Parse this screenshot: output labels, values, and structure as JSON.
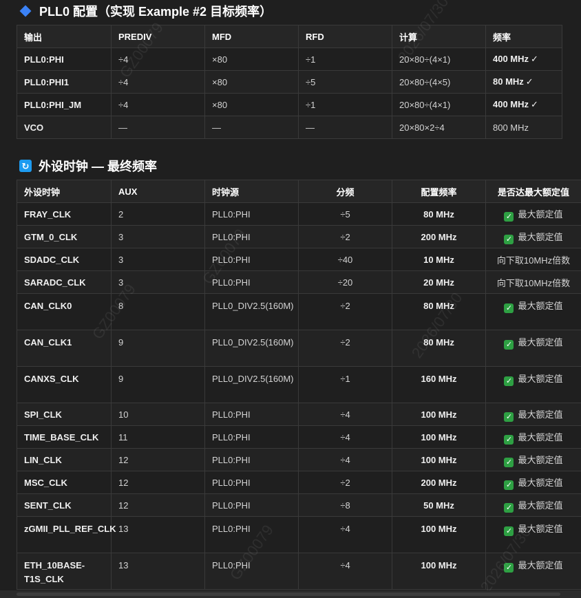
{
  "pll": {
    "title": "PLL0 配置（实现 Example #2 目标频率）",
    "headers": [
      "输出",
      "PREDIV",
      "MFD",
      "RFD",
      "计算",
      "频率"
    ],
    "rows": [
      {
        "out": "PLL0:PHI",
        "prediv": "÷4",
        "mfd": "×80",
        "rfd": "÷1",
        "calc": "20×80÷(4×1)",
        "freq": "400 MHz",
        "check": "✓"
      },
      {
        "out": "PLL0:PHI1",
        "prediv": "÷4",
        "mfd": "×80",
        "rfd": "÷5",
        "calc": "20×80÷(4×5)",
        "freq": "80 MHz",
        "check": "✓"
      },
      {
        "out": "PLL0:PHI_JM",
        "prediv": "÷4",
        "mfd": "×80",
        "rfd": "÷1",
        "calc": "20×80÷(4×1)",
        "freq": "400 MHz",
        "check": "✓"
      },
      {
        "out": "VCO",
        "prediv": "—",
        "mfd": "—",
        "rfd": "—",
        "calc": "20×80×2÷4",
        "freq": "800 MHz",
        "check": ""
      }
    ]
  },
  "periph": {
    "title": "外设时钟 — 最终频率",
    "headers": [
      "外设时钟",
      "AUX",
      "时钟源",
      "分频",
      "配置频率",
      "是否达最大额定值"
    ],
    "rows": [
      {
        "name": "FRAY_CLK",
        "aux": "2",
        "src": "PLL0:PHI",
        "div": "÷5",
        "freq": "80 MHz",
        "status": "最大额定值",
        "ok": true
      },
      {
        "name": "GTM_0_CLK",
        "aux": "3",
        "src": "PLL0:PHI",
        "div": "÷2",
        "freq": "200 MHz",
        "status": "最大额定值",
        "ok": true
      },
      {
        "name": "SDADC_CLK",
        "aux": "3",
        "src": "PLL0:PHI",
        "div": "÷40",
        "freq": "10 MHz",
        "status": "向下取10MHz倍数",
        "ok": false
      },
      {
        "name": "SARADC_CLK",
        "aux": "3",
        "src": "PLL0:PHI",
        "div": "÷20",
        "freq": "20 MHz",
        "status": "向下取10MHz倍数",
        "ok": false
      },
      {
        "name": "CAN_CLK0",
        "aux": "8",
        "src": "PLL0_DIV2.5(160M)",
        "div": "÷2",
        "freq": "80 MHz",
        "status": "最大额定值",
        "ok": true,
        "tall": true
      },
      {
        "name": "CAN_CLK1",
        "aux": "9",
        "src": "PLL0_DIV2.5(160M)",
        "div": "÷2",
        "freq": "80 MHz",
        "status": "最大额定值",
        "ok": true,
        "tall": true
      },
      {
        "name": "CANXS_CLK",
        "aux": "9",
        "src": "PLL0_DIV2.5(160M)",
        "div": "÷1",
        "freq": "160 MHz",
        "status": "最大额定值",
        "ok": true,
        "tall": true
      },
      {
        "name": "SPI_CLK",
        "aux": "10",
        "src": "PLL0:PHI",
        "div": "÷4",
        "freq": "100 MHz",
        "status": "最大额定值",
        "ok": true
      },
      {
        "name": "TIME_BASE_CLK",
        "aux": "11",
        "src": "PLL0:PHI",
        "div": "÷4",
        "freq": "100 MHz",
        "status": "最大额定值",
        "ok": true
      },
      {
        "name": "LIN_CLK",
        "aux": "12",
        "src": "PLL0:PHI",
        "div": "÷4",
        "freq": "100 MHz",
        "status": "最大额定值",
        "ok": true
      },
      {
        "name": "MSC_CLK",
        "aux": "12",
        "src": "PLL0:PHI",
        "div": "÷2",
        "freq": "200 MHz",
        "status": "最大额定值",
        "ok": true
      },
      {
        "name": "SENT_CLK",
        "aux": "12",
        "src": "PLL0:PHI",
        "div": "÷8",
        "freq": "50 MHz",
        "status": "最大额定值",
        "ok": true
      },
      {
        "name": "zGMII_PLL_REF_CLK",
        "aux": "13",
        "src": "PLL0:PHI",
        "div": "÷4",
        "freq": "100 MHz",
        "status": "最大额定值",
        "ok": true,
        "tall": true
      },
      {
        "name": "ETH_10BASE-T1S_CLK",
        "aux": "13",
        "src": "PLL0:PHI",
        "div": "÷4",
        "freq": "100 MHz",
        "status": "最大额定值",
        "ok": true,
        "tall": true
      }
    ]
  },
  "watermark": {
    "id": "GZ00079",
    "date": "2026/07/30"
  }
}
